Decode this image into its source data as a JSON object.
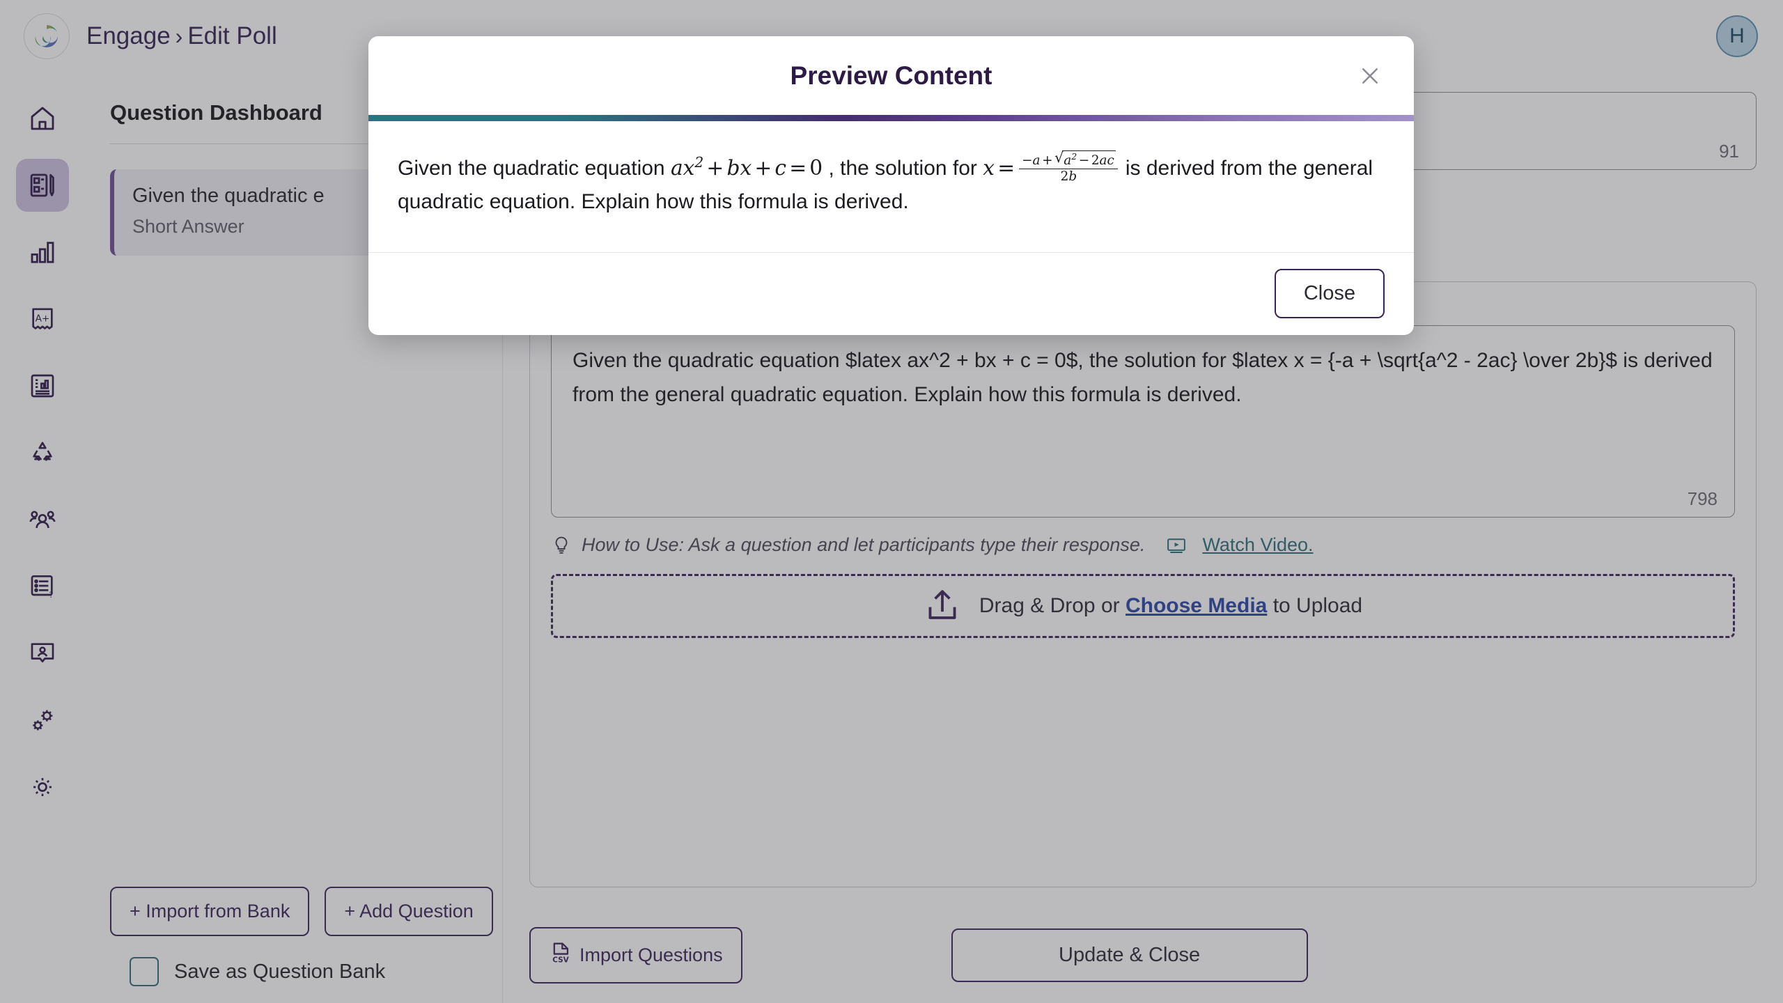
{
  "app": {
    "brand_logo_icon": "spiral-logo-icon",
    "breadcrumb_root": "Engage",
    "breadcrumb_separator": "›",
    "breadcrumb_current": "Edit Poll",
    "avatar_initial": "H"
  },
  "sidebar": {
    "items": [
      {
        "icon": "home-icon",
        "name": "sidebar-item-home",
        "active": false
      },
      {
        "icon": "poll-edit-icon",
        "name": "sidebar-item-polls",
        "active": true
      },
      {
        "icon": "bar-chart-icon",
        "name": "sidebar-item-analytics",
        "active": false
      },
      {
        "icon": "grade-a-plus-icon",
        "name": "sidebar-item-grades",
        "active": false
      },
      {
        "icon": "report-document-icon",
        "name": "sidebar-item-reports",
        "active": false
      },
      {
        "icon": "recycle-icon",
        "name": "sidebar-item-recycle",
        "active": false
      },
      {
        "icon": "users-group-icon",
        "name": "sidebar-item-participants",
        "active": false
      },
      {
        "icon": "question-list-icon",
        "name": "sidebar-item-question-bank",
        "active": false
      },
      {
        "icon": "presentation-icon",
        "name": "sidebar-item-presentation",
        "active": false
      },
      {
        "icon": "gears-icon",
        "name": "sidebar-item-integrations",
        "active": false
      },
      {
        "icon": "gear-icon",
        "name": "sidebar-item-settings",
        "active": false
      }
    ]
  },
  "left_panel": {
    "title": "Question Dashboard",
    "question_card": {
      "text": "Given the quadratic e",
      "type": "Short Answer"
    },
    "import_from_bank_label": "+ Import from Bank",
    "add_question_label": "+ Add Question",
    "save_as_question_bank_label": "Save as Question Bank",
    "save_as_question_bank_checked": false
  },
  "main_panel": {
    "title_field": {
      "value": "",
      "char_count": "91"
    },
    "content_field": {
      "value": "Given the quadratic equation $latex ax^2 + bx + c = 0$, the solution for $latex x = {-a + \\sqrt{a^2 - 2ac} \\over 2b}$ is derived from the general quadratic equation. Explain how this formula is derived.",
      "char_count": "798"
    },
    "how_to_use": {
      "bulb_icon": "lightbulb-icon",
      "text": "How to Use: Ask a question and let participants type their response.",
      "video_icon": "video-play-icon",
      "link_label": "Watch Video."
    },
    "upload": {
      "icon": "upload-arrow-icon",
      "prefix": "Drag & Drop or",
      "link_label": "Choose Media",
      "suffix": "to Upload"
    },
    "import_questions_label": "Import Questions",
    "import_questions_icon": "csv-file-icon",
    "update_close_label": "Update & Close"
  },
  "modal": {
    "title": "Preview Content",
    "close_icon": "close-x-icon",
    "close_button_label": "Close",
    "preview": {
      "lead": "Given the quadratic equation",
      "equation_1": "ax² + bx + c = 0",
      "middle": ", the solution for",
      "equation_2": "x = (−a + √(a² − 2ac)) / 2b",
      "tail": "is derived from the general quadratic equation. Explain how this formula is derived.",
      "full_text": "Given the quadratic equation ax² + bx + c = 0 , the solution for x = (−a+√(a²−2ac))/(2b) is derived from the general quadratic equation. Explain how this formula is derived."
    }
  },
  "colors": {
    "brand_purple": "#3a2357",
    "accent_teal": "#2d7480",
    "accent_purple": "#452d6e",
    "accent_light_purple": "#a392c9",
    "link_blue": "#2b46a6",
    "active_nav_bg": "#cdc2e0",
    "avatar_bg": "#bcd8e8"
  }
}
